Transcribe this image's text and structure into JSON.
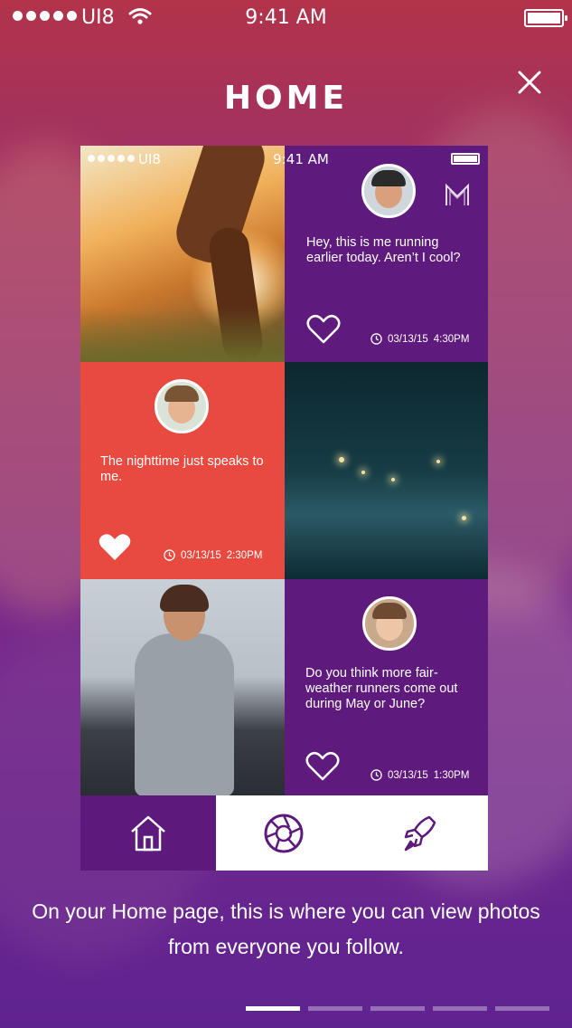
{
  "status_bar": {
    "carrier": "UI8",
    "time": "9:41 AM"
  },
  "header": {
    "title": "HOME",
    "close_icon": "close-icon"
  },
  "mock_status": {
    "carrier": "UI8",
    "time": "9:41 AM"
  },
  "posts": [
    {
      "text": "Hey, this is me running earlier today. Aren’t I cool?",
      "date": "03/13/15",
      "time": "4:30PM",
      "liked": false
    },
    {
      "text": "The nighttime just speaks to me.",
      "date": "03/13/15",
      "time": "2:30PM",
      "liked": true
    },
    {
      "text": "Do you think more fair-weather runners come out during May or June?",
      "date": "03/13/15",
      "time": "1:30PM",
      "liked": false
    }
  ],
  "nav": {
    "items": [
      {
        "icon": "home-icon",
        "active": true
      },
      {
        "icon": "camera-shutter-icon",
        "active": false
      },
      {
        "icon": "rocket-icon",
        "active": false
      }
    ]
  },
  "caption": "On your Home page, this is where you can view photos from everyone you follow.",
  "pager": {
    "count": 5,
    "active_index": 0
  },
  "colors": {
    "purple": "#5d1a7c",
    "red": "#e84a40",
    "white": "#ffffff"
  }
}
